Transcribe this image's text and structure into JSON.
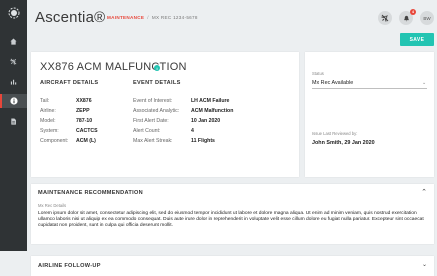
{
  "app": {
    "title": "Ascentia®"
  },
  "breadcrumb": {
    "section": "MAINTENANCE",
    "separator": "/",
    "current": "MX REC 1234-5678"
  },
  "header": {
    "badge_count": "4",
    "avatar_initials": "BW",
    "save_label": "SAVE"
  },
  "sidebar": {
    "icons": [
      "logo-icon",
      "home-icon",
      "plane-icon",
      "chart-icon",
      "info-icon",
      "document-icon"
    ],
    "active_index": 4
  },
  "flight": {
    "title": "XX876 ACM MALFUNCTION",
    "info_icon": "i"
  },
  "aircraft_details": {
    "heading": "AIRCRAFT DETAILS",
    "rows": [
      {
        "label": "Tail:",
        "value": "XX876"
      },
      {
        "label": "Airline:",
        "value": "ZEPP"
      },
      {
        "label": "Model:",
        "value": "787-10"
      },
      {
        "label": "System:",
        "value": "CACTCS"
      },
      {
        "label": "Component:",
        "value": "ACM (L)"
      }
    ]
  },
  "event_details": {
    "heading": "EVENT DETAILS",
    "rows": [
      {
        "label": "Event of Interest:",
        "value": "LH ACM Failure"
      },
      {
        "label": "Associated Analytic:",
        "value": "ACM Malfunction"
      },
      {
        "label": "First Alert Date:",
        "value": "10 Jan 2020"
      },
      {
        "label": "Alert Count:",
        "value": "4"
      },
      {
        "label": "Max Alert Streak:",
        "value": "11 Flights"
      }
    ]
  },
  "status": {
    "label": "Status",
    "value": "Mx Rec Available",
    "reviewed_label": "Issue Last Reviewed by:",
    "reviewed_value": "John Smith, 29 Jan 2020"
  },
  "maintenance": {
    "heading": "MAINTENANCE RECOMMENDATION",
    "sub_label": "Mx Rec Details",
    "body": "Lorem ipsum dolor sit amet, consectetur adipiscing elit, sed do eiusmod tempor incididunt ut labore et dolore magna aliqua. Ut enim ad minim veniam, quis nostrud exercitation ullamco laboris nisi ut aliquip ex ea commodo consequat. Duis aute irure dolor in reprehenderit in voluptate velit esse cillum dolore eu fugiat nulla pariatur. Excepteur sint occaecat cupidatat non proident, sunt in culpa qui officia deserunt mollit."
  },
  "airline_followup": {
    "heading": "AIRLINE FOLLOW-UP"
  },
  "colors": {
    "accent": "#e8463a",
    "teal": "#22c4b2",
    "sidebar": "#2f3335"
  }
}
